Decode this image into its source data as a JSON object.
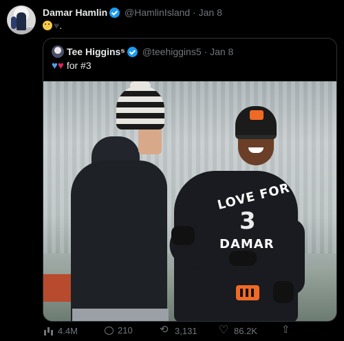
{
  "tweet": {
    "author_name": "Damar Hamlin",
    "handle": "@HamlinIsland",
    "separator": "·",
    "date": "Jan 8",
    "emoji_text_tail": ".",
    "icons": [
      "salute-emoji",
      "black-heart-emoji",
      "verified-badge-icon"
    ]
  },
  "quoted": {
    "author_name": "Tee Higgins⁵",
    "handle": "@teehiggins5",
    "separator": "·",
    "date": "Jan 8",
    "text": "for #3",
    "hearts": [
      "blue-heart",
      "red-heart"
    ],
    "photo": {
      "shirt_line1": "LOVE FOR",
      "shirt_number": "3",
      "shirt_line2": "DAMAR"
    }
  },
  "actions": {
    "views": "4.4M",
    "replies": "210",
    "retweets": "3,131",
    "likes": "86.2K"
  },
  "colors": {
    "background": "#000000",
    "text": "#e7e9ea",
    "muted": "#71767b",
    "verified": "#1d9bf0",
    "border": "#2f3336"
  }
}
